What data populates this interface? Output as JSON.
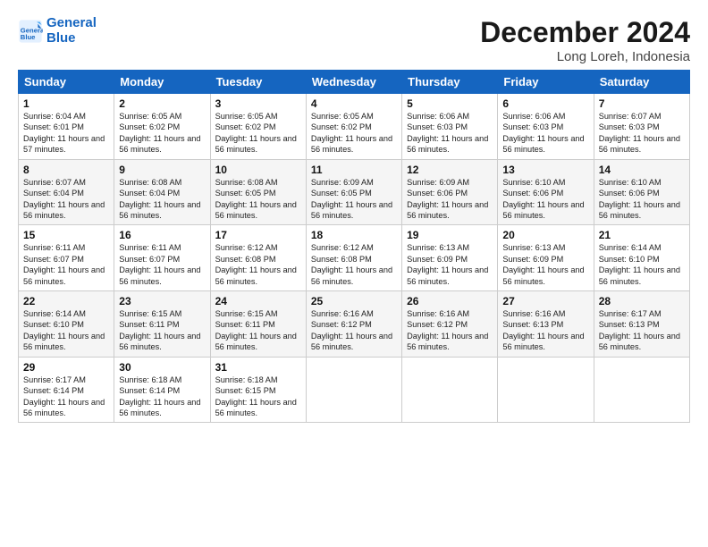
{
  "logo": {
    "line1": "General",
    "line2": "Blue"
  },
  "title": "December 2024",
  "location": "Long Loreh, Indonesia",
  "weekdays": [
    "Sunday",
    "Monday",
    "Tuesday",
    "Wednesday",
    "Thursday",
    "Friday",
    "Saturday"
  ],
  "weeks": [
    [
      {
        "day": 1,
        "sunrise": "6:04 AM",
        "sunset": "6:01 PM",
        "daylight": "11 hours and 57 minutes."
      },
      {
        "day": 2,
        "sunrise": "6:05 AM",
        "sunset": "6:02 PM",
        "daylight": "11 hours and 56 minutes."
      },
      {
        "day": 3,
        "sunrise": "6:05 AM",
        "sunset": "6:02 PM",
        "daylight": "11 hours and 56 minutes."
      },
      {
        "day": 4,
        "sunrise": "6:05 AM",
        "sunset": "6:02 PM",
        "daylight": "11 hours and 56 minutes."
      },
      {
        "day": 5,
        "sunrise": "6:06 AM",
        "sunset": "6:03 PM",
        "daylight": "11 hours and 56 minutes."
      },
      {
        "day": 6,
        "sunrise": "6:06 AM",
        "sunset": "6:03 PM",
        "daylight": "11 hours and 56 minutes."
      },
      {
        "day": 7,
        "sunrise": "6:07 AM",
        "sunset": "6:03 PM",
        "daylight": "11 hours and 56 minutes."
      }
    ],
    [
      {
        "day": 8,
        "sunrise": "6:07 AM",
        "sunset": "6:04 PM",
        "daylight": "11 hours and 56 minutes."
      },
      {
        "day": 9,
        "sunrise": "6:08 AM",
        "sunset": "6:04 PM",
        "daylight": "11 hours and 56 minutes."
      },
      {
        "day": 10,
        "sunrise": "6:08 AM",
        "sunset": "6:05 PM",
        "daylight": "11 hours and 56 minutes."
      },
      {
        "day": 11,
        "sunrise": "6:09 AM",
        "sunset": "6:05 PM",
        "daylight": "11 hours and 56 minutes."
      },
      {
        "day": 12,
        "sunrise": "6:09 AM",
        "sunset": "6:06 PM",
        "daylight": "11 hours and 56 minutes."
      },
      {
        "day": 13,
        "sunrise": "6:10 AM",
        "sunset": "6:06 PM",
        "daylight": "11 hours and 56 minutes."
      },
      {
        "day": 14,
        "sunrise": "6:10 AM",
        "sunset": "6:06 PM",
        "daylight": "11 hours and 56 minutes."
      }
    ],
    [
      {
        "day": 15,
        "sunrise": "6:11 AM",
        "sunset": "6:07 PM",
        "daylight": "11 hours and 56 minutes."
      },
      {
        "day": 16,
        "sunrise": "6:11 AM",
        "sunset": "6:07 PM",
        "daylight": "11 hours and 56 minutes."
      },
      {
        "day": 17,
        "sunrise": "6:12 AM",
        "sunset": "6:08 PM",
        "daylight": "11 hours and 56 minutes."
      },
      {
        "day": 18,
        "sunrise": "6:12 AM",
        "sunset": "6:08 PM",
        "daylight": "11 hours and 56 minutes."
      },
      {
        "day": 19,
        "sunrise": "6:13 AM",
        "sunset": "6:09 PM",
        "daylight": "11 hours and 56 minutes."
      },
      {
        "day": 20,
        "sunrise": "6:13 AM",
        "sunset": "6:09 PM",
        "daylight": "11 hours and 56 minutes."
      },
      {
        "day": 21,
        "sunrise": "6:14 AM",
        "sunset": "6:10 PM",
        "daylight": "11 hours and 56 minutes."
      }
    ],
    [
      {
        "day": 22,
        "sunrise": "6:14 AM",
        "sunset": "6:10 PM",
        "daylight": "11 hours and 56 minutes."
      },
      {
        "day": 23,
        "sunrise": "6:15 AM",
        "sunset": "6:11 PM",
        "daylight": "11 hours and 56 minutes."
      },
      {
        "day": 24,
        "sunrise": "6:15 AM",
        "sunset": "6:11 PM",
        "daylight": "11 hours and 56 minutes."
      },
      {
        "day": 25,
        "sunrise": "6:16 AM",
        "sunset": "6:12 PM",
        "daylight": "11 hours and 56 minutes."
      },
      {
        "day": 26,
        "sunrise": "6:16 AM",
        "sunset": "6:12 PM",
        "daylight": "11 hours and 56 minutes."
      },
      {
        "day": 27,
        "sunrise": "6:16 AM",
        "sunset": "6:13 PM",
        "daylight": "11 hours and 56 minutes."
      },
      {
        "day": 28,
        "sunrise": "6:17 AM",
        "sunset": "6:13 PM",
        "daylight": "11 hours and 56 minutes."
      }
    ],
    [
      {
        "day": 29,
        "sunrise": "6:17 AM",
        "sunset": "6:14 PM",
        "daylight": "11 hours and 56 minutes."
      },
      {
        "day": 30,
        "sunrise": "6:18 AM",
        "sunset": "6:14 PM",
        "daylight": "11 hours and 56 minutes."
      },
      {
        "day": 31,
        "sunrise": "6:18 AM",
        "sunset": "6:15 PM",
        "daylight": "11 hours and 56 minutes."
      },
      null,
      null,
      null,
      null
    ]
  ]
}
